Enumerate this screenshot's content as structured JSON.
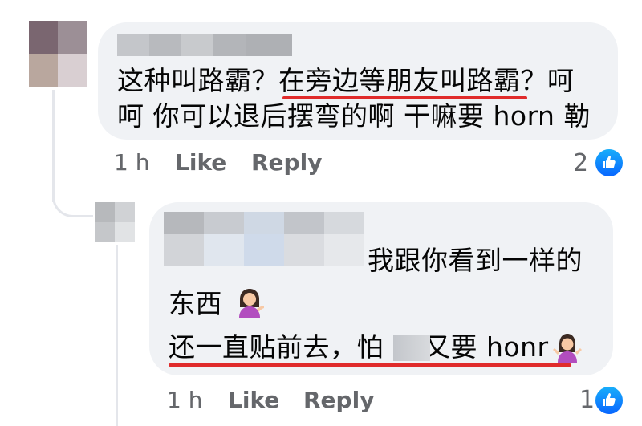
{
  "comment1": {
    "line1_a": "这种叫路霸？",
    "line1_b": "在旁边等朋友叫路霸",
    "line1_c": "？呵",
    "line2": "呵 你可以退后摆弯的啊 干嘛要 horn 勒",
    "time": "1 h",
    "like_label": "Like",
    "reply_label": "Reply",
    "reaction_count": "2"
  },
  "comment2": {
    "line1": "我跟你看到一样的",
    "line2": "东西",
    "line3_a": "还一直贴前去，怕",
    "line3_b": "又要 honr",
    "time": "1 h",
    "like_label": "Like",
    "reply_label": "Reply",
    "reaction_count": "1"
  },
  "icons": {
    "reaction": "thumbs-up-icon",
    "emoji1": "woman-tipping-hand-emoji",
    "emoji2": "woman-shrugging-emoji"
  },
  "colors": {
    "bubble": "#f0f2f5",
    "highlight_underline": "#e02b2b",
    "like_blue": "#0866ff",
    "meta_text": "#65676b"
  }
}
